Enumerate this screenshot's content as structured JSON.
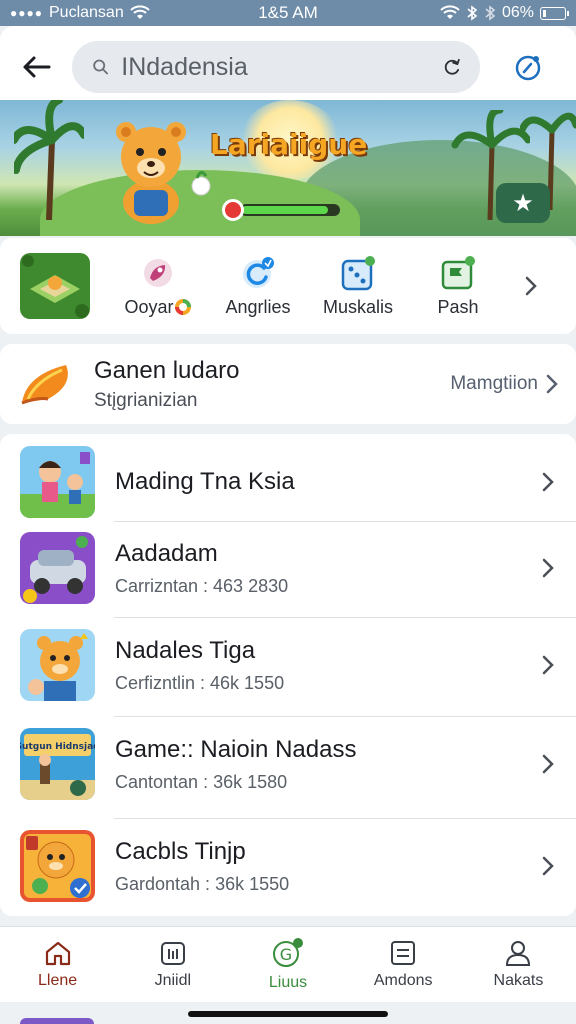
{
  "status_bar": {
    "carrier": "Puclansan",
    "time": "1&5 AM",
    "battery": "06%"
  },
  "header": {
    "search_value": "INdadensia",
    "back_icon": "arrow-left-icon",
    "refresh_icon": "refresh-icon",
    "action_icon": "compass-icon"
  },
  "banner": {
    "title": "Lariaiigue",
    "progress": 0.9,
    "fav_icon": "star-icon"
  },
  "categories": [
    {
      "label": "Ooyar",
      "icon": "tag-icon",
      "color": "#c0417a"
    },
    {
      "label": "Angrlies",
      "icon": "refresh-badge-icon",
      "color": "#1e88e5"
    },
    {
      "label": "Muskalis",
      "icon": "dice-icon",
      "color": "#1f6fbf"
    },
    {
      "label": "Paѕh",
      "icon": "flag-icon",
      "color": "#2e8b3a"
    }
  ],
  "featured": {
    "title": "Ganen ludaro",
    "subtitle": "Stįgrianizian",
    "link": "Mamgtiion"
  },
  "list": [
    {
      "title": "Mading Tna Ksia",
      "subtitle": ""
    },
    {
      "title": "Aadadam",
      "subtitle": "Carrizntan :  463 2830"
    },
    {
      "title": "Nadales Tiga",
      "subtitle": "Cerfizntlin :  46k 1550"
    },
    {
      "title": "Game:: Naioin Nadass",
      "subtitle": "Cantontan :  36k 1580"
    },
    {
      "title": "Cacbls Tinjp",
      "subtitle": "Gardontah :  36k 1550"
    }
  ],
  "list_thumb_text": "Gutgun Hidnsjao",
  "bottom_nav": [
    {
      "label": "Llene",
      "icon": "home-icon"
    },
    {
      "label": "Jniidl",
      "icon": "info-box-icon"
    },
    {
      "label": "Liuus",
      "icon": "g-badge-icon"
    },
    {
      "label": "Amdons",
      "icon": "list-icon"
    },
    {
      "label": "Nakats",
      "icon": "person-icon"
    }
  ]
}
